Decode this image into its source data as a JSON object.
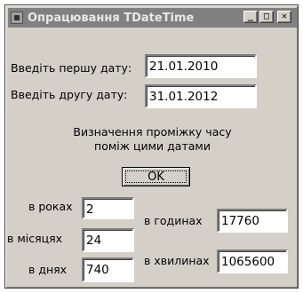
{
  "window": {
    "title": "Опрацювання TDateTime",
    "controls": {
      "minimize": "_",
      "maximize": "□",
      "close": "✕"
    }
  },
  "form": {
    "first_date_label": "Введіть першу дату:",
    "first_date_value": "21.01.2010",
    "second_date_label": "Введіть другу дату:",
    "second_date_value": "31.01.2012",
    "description_line1": "Визначення проміжку часу",
    "description_line2": "поміж цими датами",
    "ok_label": "OK"
  },
  "results": {
    "years_label": "в роках",
    "years_value": "2",
    "months_label": "в місяцях",
    "months_value": "24",
    "days_label": "в днях",
    "days_value": "740",
    "hours_label": "в годинах",
    "hours_value": "17760",
    "minutes_label": "в хвилинах",
    "minutes_value": "1065600"
  }
}
